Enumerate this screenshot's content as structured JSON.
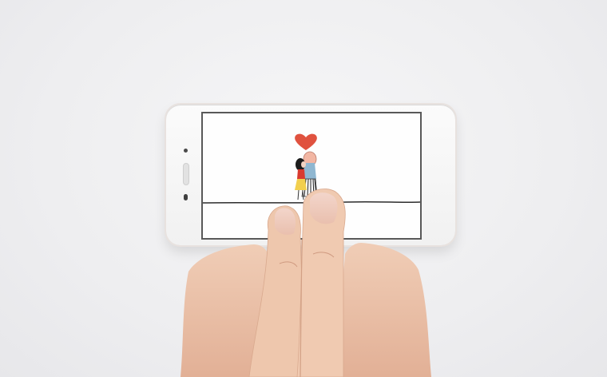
{
  "scene": {
    "description_icon": "phone-in-hands",
    "screen_illustration": "couple-kissing-under-heart",
    "colors": {
      "background": "#eeeef0",
      "phone_body": "#f6f6f6",
      "screen_border": "#595959",
      "heart": "#e0523f",
      "skin": "#e8c0a5"
    }
  }
}
